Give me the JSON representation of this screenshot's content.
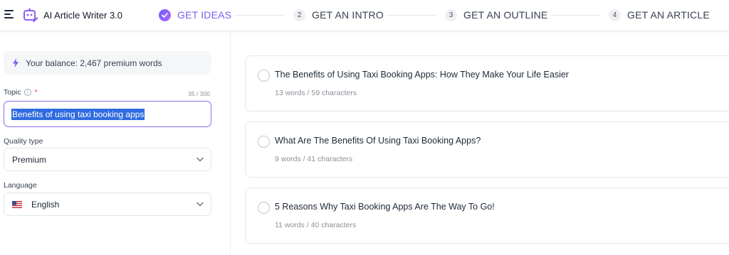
{
  "app": {
    "title": "AI Article Writer 3.0",
    "brand_color": "#7c5cf0"
  },
  "steps": [
    {
      "number": "",
      "label": "GET IDEAS",
      "state": "done"
    },
    {
      "number": "2",
      "label": "GET AN INTRO",
      "state": "todo"
    },
    {
      "number": "3",
      "label": "GET AN OUTLINE",
      "state": "todo"
    },
    {
      "number": "4",
      "label": "GET AN ARTICLE",
      "state": "todo"
    }
  ],
  "sidebar": {
    "balance": "Your balance: 2,467 premium words",
    "topic": {
      "label": "Topic",
      "required_mark": "*",
      "count": "35 / 300",
      "value": "Benefits of using taxi booking apps"
    },
    "quality": {
      "label": "Quality type",
      "value": "Premium"
    },
    "language": {
      "label": "Language",
      "value": "English"
    }
  },
  "ideas": [
    {
      "title": "The Benefits of Using Taxi Booking Apps: How They Make Your Life Easier",
      "meta": "13 words / 59 characters"
    },
    {
      "title": "What Are The Benefits Of Using Taxi Booking Apps?",
      "meta": "9 words / 41 characters"
    },
    {
      "title": "5 Reasons Why Taxi Booking Apps Are The Way To Go!",
      "meta": "11 words / 40 characters"
    }
  ]
}
